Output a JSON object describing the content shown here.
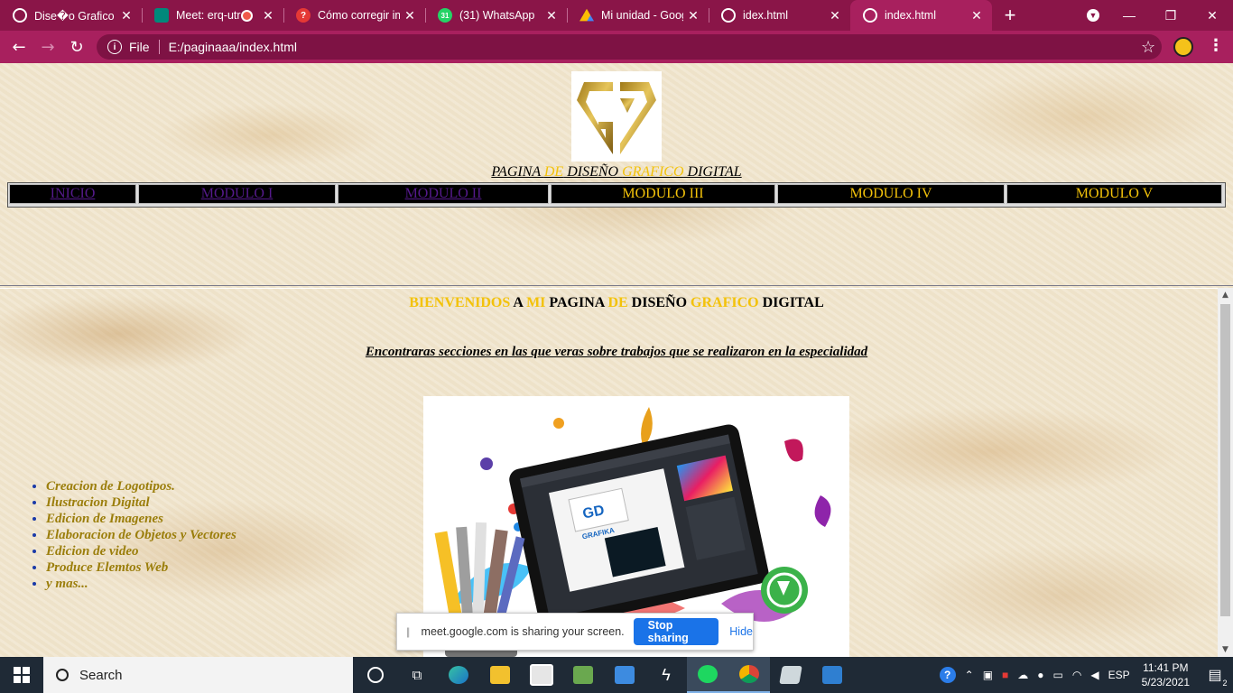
{
  "browser": {
    "tabs": [
      {
        "title": "Dise�o Grafico",
        "favicon": "globe-icon",
        "color": "#ffffff",
        "active": false
      },
      {
        "title": "Meet: erq-utr",
        "favicon": "meet-icon",
        "color": "#00897b",
        "active": false,
        "recording": true
      },
      {
        "title": "Cómo corregir im",
        "favicon": "question-icon",
        "color": "#e53935",
        "active": false
      },
      {
        "title": "(31) WhatsApp",
        "favicon": "whatsapp-icon",
        "color": "#25d366",
        "active": false,
        "badge": "31"
      },
      {
        "title": "Mi unidad - Goog",
        "favicon": "drive-icon",
        "color": "#fbbc04",
        "active": false
      },
      {
        "title": "idex.html",
        "favicon": "globe-icon",
        "color": "#ffffff",
        "active": false
      },
      {
        "title": "index.html",
        "favicon": "globe-icon",
        "color": "#ffffff",
        "active": true
      }
    ],
    "new_tab": "+",
    "window_controls": {
      "minimize": "—",
      "restore": "❐",
      "close": "✕"
    },
    "nav": {
      "back": "←",
      "forward": "→",
      "reload": "↻"
    },
    "address": {
      "scheme_label": "File",
      "url": "E:/paginaaa/index.html"
    },
    "star": "☆",
    "menu": "⋮"
  },
  "page": {
    "title": {
      "part1": "PAGINA ",
      "part2": "DE",
      "part3": " DISEÑO ",
      "part4": "GRAFICO",
      "part5": " DIGITAL"
    },
    "menu": [
      {
        "label": "INICIO",
        "link": true
      },
      {
        "label": "MODULO I",
        "link": true
      },
      {
        "label": "MODULO II",
        "link": true
      },
      {
        "label": "MODULO III",
        "link": false
      },
      {
        "label": "MODULO IV",
        "link": false
      },
      {
        "label": "MODULO V",
        "link": false
      }
    ],
    "welcome": {
      "w1": "BIENVENIDOS",
      "w2": " A ",
      "w3": "MI",
      "w4": " PAGINA ",
      "w5": "DE",
      "w6": " DISEÑO ",
      "w7": "GRAFICO",
      "w8": " DIGITAL"
    },
    "subtitle": "Encontraras secciones en las que veras sobre trabajos que se realizaron en la especialidad",
    "services": [
      "Creacion de Logotipos.",
      "Ilustracion Digital",
      "Edicion de Imagenes",
      "Elaboracion de Objetos y Vectores",
      "Edicion de video",
      "Produce Elemtos Web",
      "y mas..."
    ],
    "hero_logo_text": "GRAFIKA",
    "colors": {
      "gold": "#f3c20a",
      "link": "#551a8b",
      "list": "#9b7e0b"
    }
  },
  "share_bar": {
    "message": "meet.google.com is sharing your screen.",
    "stop_label": "Stop sharing",
    "hide_label": "Hide"
  },
  "taskbar": {
    "search_label": "Search",
    "language": "ESP",
    "time": "11:41 PM",
    "date": "5/23/2021",
    "notification_count": "2"
  }
}
